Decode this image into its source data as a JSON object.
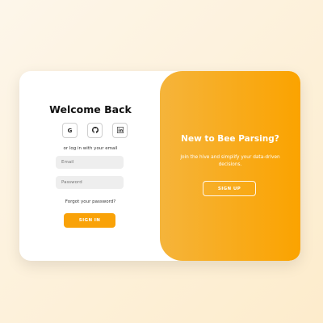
{
  "login": {
    "title": "Welcome Back",
    "social_buttons": [
      {
        "label": "G",
        "icon": "google-icon"
      },
      {
        "label": "",
        "icon": "github-icon"
      },
      {
        "label": "in",
        "icon": "linkedin-icon"
      }
    ],
    "alt_text": "or log in with your email",
    "email_placeholder": "Email",
    "email_value": "",
    "password_placeholder": "Password",
    "password_value": "",
    "forgot_label": "Forgot your password?",
    "signin_label": "SIGN IN"
  },
  "overlay": {
    "title": "New to Bee Parsing?",
    "text": "Join the hive and simplify your data-driven decisions.",
    "signup_label": "SIGN UP"
  },
  "colors": {
    "accent": "#f9a208",
    "background": "#fdeccc",
    "field": "#eeeeee"
  }
}
